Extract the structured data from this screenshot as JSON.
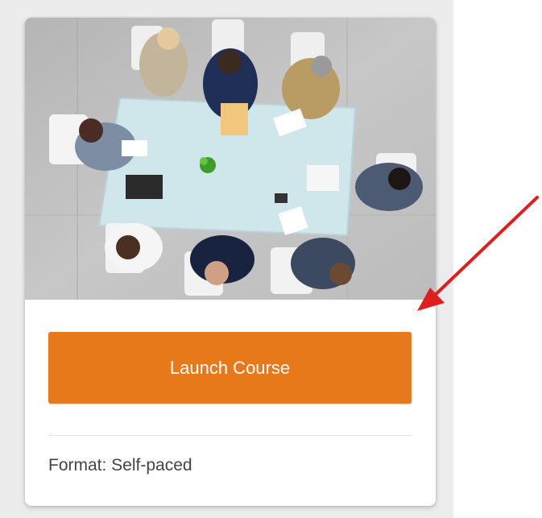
{
  "course_card": {
    "image_alt": "Team meeting around a conference table viewed from above",
    "launch_button_label": "Launch Course",
    "format_text": "Format: Self-paced"
  },
  "colors": {
    "accent": "#e8791a",
    "annotation_arrow": "#dd1f1f",
    "card_background": "#ffffff",
    "page_background": "#ececec"
  },
  "icons": {
    "annotation": "red-arrow-icon"
  }
}
